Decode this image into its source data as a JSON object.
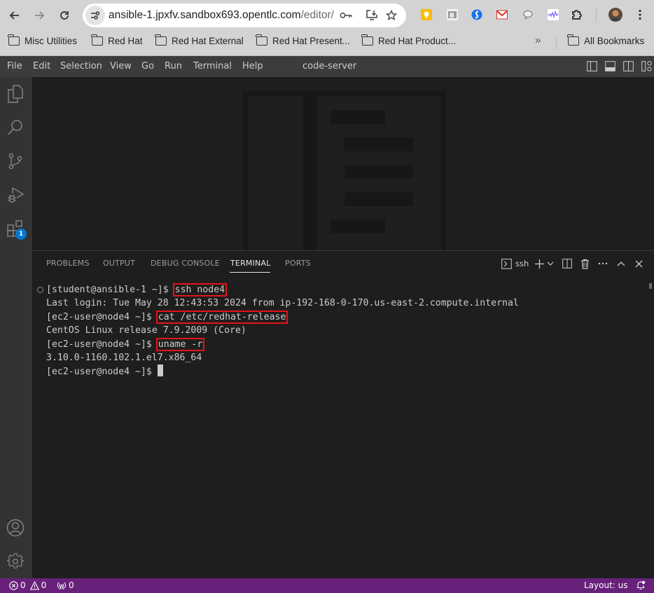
{
  "browser": {
    "url_host": "ansible-1.jpxfv.sandbox693.opentlc.com",
    "url_path": "/editor/",
    "bookmarks": [
      {
        "label": "Misc Utilities"
      },
      {
        "label": "Red Hat"
      },
      {
        "label": "Red Hat External"
      },
      {
        "label": "Red Hat Present..."
      },
      {
        "label": "Red Hat Product..."
      }
    ],
    "overflow_label": "»",
    "all_bookmarks_label": "All Bookmarks",
    "extension_colors": {
      "keep": "#fbbc04",
      "gmail": "#d93025",
      "sync": "#1a73e8"
    }
  },
  "menubar": {
    "items": [
      "File",
      "Edit",
      "Selection",
      "View",
      "Go",
      "Run",
      "Terminal",
      "Help"
    ],
    "title": "code-server"
  },
  "activity_bar": {
    "extensions_badge": "1"
  },
  "panel": {
    "tabs": [
      {
        "label": "PROBLEMS",
        "active": false
      },
      {
        "label": "OUTPUT",
        "active": false
      },
      {
        "label": "DEBUG CONSOLE",
        "active": false
      },
      {
        "label": "TERMINAL",
        "active": true
      },
      {
        "label": "PORTS",
        "active": false
      }
    ],
    "terminal_name": "ssh"
  },
  "terminal": {
    "lines": [
      {
        "prompt": "[student@ansible-1 ~]$ ",
        "command": "ssh node4",
        "highlight": true
      },
      {
        "output": "Last login: Tue May 28 12:43:53 2024 from ip-192-168-0-170.us-east-2.compute.internal"
      },
      {
        "prompt": "[ec2-user@node4 ~]$ ",
        "command": "cat /etc/redhat-release",
        "highlight": true
      },
      {
        "output": "CentOS Linux release 7.9.2009 (Core)"
      },
      {
        "prompt": "[ec2-user@node4 ~]$ ",
        "command": "uname -r",
        "highlight": true
      },
      {
        "output": "3.10.0-1160.102.1.el7.x86_64"
      },
      {
        "prompt": "[ec2-user@node4 ~]$ ",
        "command": ""
      }
    ],
    "highlight_color": "#e3141a"
  },
  "statusbar": {
    "errors": "0",
    "warnings": "0",
    "ports": "0",
    "layout": "Layout: us",
    "background": "#68217a"
  }
}
